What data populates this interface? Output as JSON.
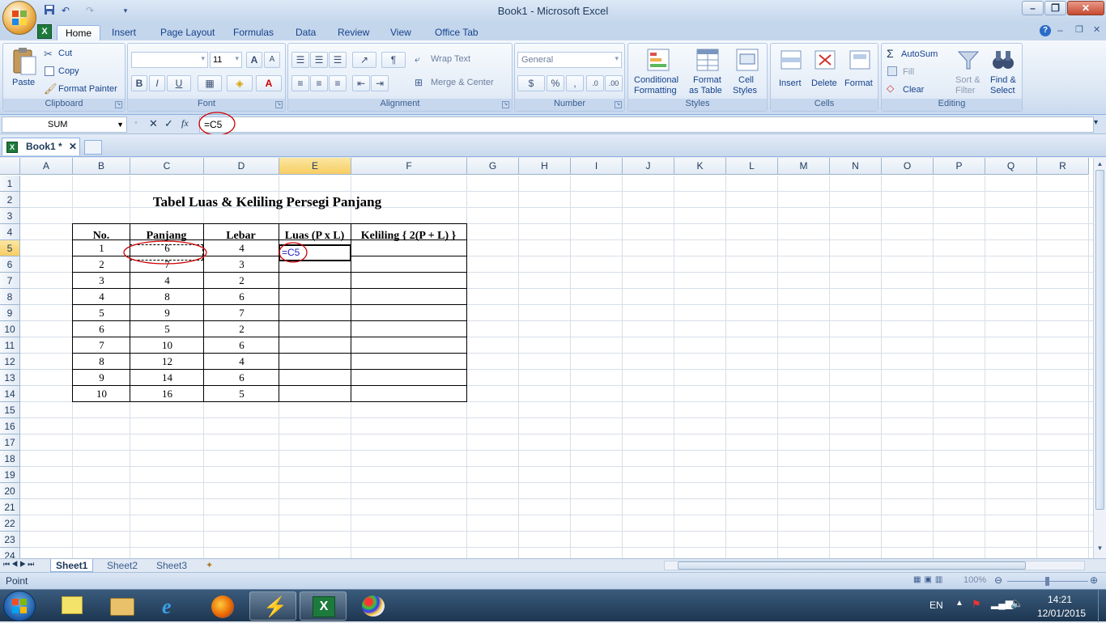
{
  "window": {
    "title": "Book1 - Microsoft Excel"
  },
  "quick_access": {
    "icons": [
      "excel-icon",
      "save-icon",
      "undo-icon",
      "redo-icon",
      "customize-icon"
    ]
  },
  "tabs": [
    {
      "label": "Home"
    },
    {
      "label": "Insert"
    },
    {
      "label": "Page Layout"
    },
    {
      "label": "Formulas"
    },
    {
      "label": "Data"
    },
    {
      "label": "Review"
    },
    {
      "label": "View"
    },
    {
      "label": "Office Tab"
    }
  ],
  "ribbon": {
    "clipboard": {
      "label": "Clipboard",
      "paste": "Paste",
      "cut": "Cut",
      "copy": "Copy",
      "format_painter": "Format Painter"
    },
    "font": {
      "label": "Font",
      "font_name": "",
      "font_size": "11",
      "bold": "B",
      "italic": "I",
      "underline": "U",
      "font_color_glyph": "A"
    },
    "alignment": {
      "label": "Alignment",
      "wrap_text": "Wrap Text",
      "merge_center": "Merge & Center"
    },
    "number": {
      "label": "Number",
      "format": "General",
      "percent": "%",
      "comma": ","
    },
    "styles": {
      "label": "Styles",
      "conditional": "Conditional",
      "conditional2": "Formatting",
      "format_table": "Format",
      "format_table2": "as Table",
      "cell_styles": "Cell",
      "cell_styles2": "Styles"
    },
    "cells": {
      "label": "Cells",
      "insert": "Insert",
      "delete": "Delete",
      "format": "Format"
    },
    "editing": {
      "label": "Editing",
      "autosum": "AutoSum",
      "fill": "Fill",
      "clear": "Clear",
      "sort": "Sort &",
      "sort2": "Filter",
      "find": "Find &",
      "find2": "Select"
    }
  },
  "formula_bar": {
    "name_box": "SUM",
    "formula": "=C5"
  },
  "document_tab": {
    "label": "Book1 *"
  },
  "sheet": {
    "columns": [
      "A",
      "B",
      "C",
      "D",
      "E",
      "F",
      "G",
      "H",
      "I",
      "J",
      "K",
      "L",
      "M",
      "N",
      "O",
      "P",
      "Q",
      "R"
    ],
    "rows": [
      "1",
      "2",
      "3",
      "4",
      "5",
      "6",
      "7",
      "8",
      "9",
      "10",
      "11",
      "12",
      "13",
      "14",
      "15",
      "16",
      "17",
      "18",
      "19",
      "20",
      "21",
      "22",
      "23",
      "24"
    ],
    "title": "Tabel Luas & Keliling Persegi Panjang",
    "headers": [
      "No.",
      "Panjang",
      "Lebar",
      "Luas (P x L)",
      "Keliling { 2(P + L) }"
    ],
    "data": [
      [
        "1",
        "6",
        "4"
      ],
      [
        "2",
        "7",
        "3"
      ],
      [
        "3",
        "4",
        "2"
      ],
      [
        "4",
        "8",
        "6"
      ],
      [
        "5",
        "9",
        "7"
      ],
      [
        "6",
        "5",
        "2"
      ],
      [
        "7",
        "10",
        "6"
      ],
      [
        "8",
        "12",
        "4"
      ],
      [
        "9",
        "14",
        "6"
      ],
      [
        "10",
        "16",
        "5"
      ]
    ],
    "editing_cell": "E5",
    "editing_value": "=C5"
  },
  "sheet_tabs": [
    {
      "label": "Sheet1"
    },
    {
      "label": "Sheet2"
    },
    {
      "label": "Sheet3"
    }
  ],
  "status": {
    "mode": "Point",
    "zoom": "100%"
  },
  "taskbar": {
    "language": "EN",
    "time": "14:21",
    "date": "12/01/2015"
  },
  "colors": {
    "ribbon_blue": "#c4d6ec",
    "selected_header": "#f7cd63",
    "reference_blue": "#2020c0",
    "annotation_red": "#cc0000"
  }
}
